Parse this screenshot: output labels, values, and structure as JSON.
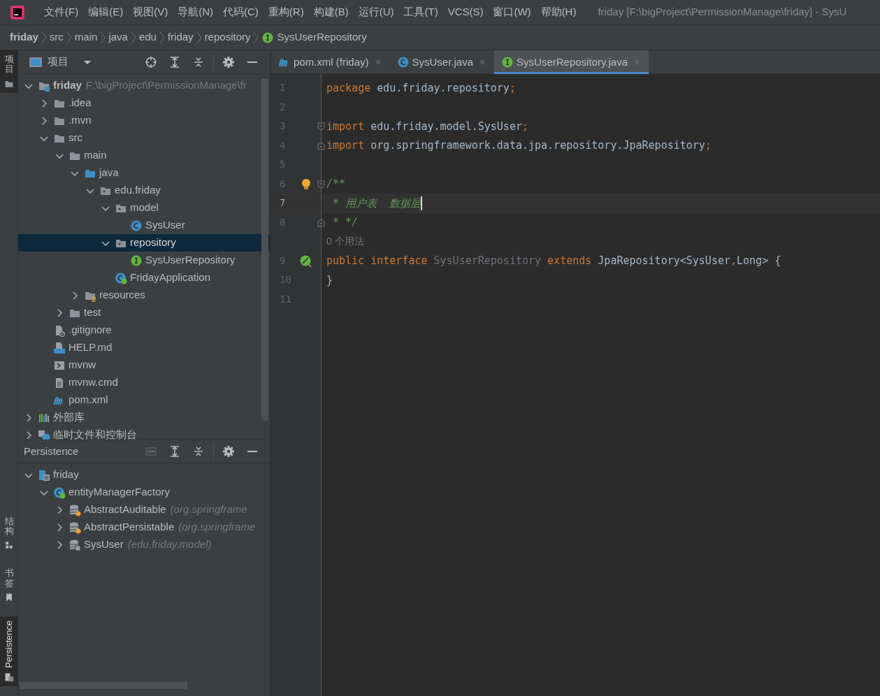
{
  "window": {
    "title": "friday [F:\\bigProject\\PermissionManage\\friday] - SysU"
  },
  "menu": [
    "文件(F)",
    "编辑(E)",
    "视图(V)",
    "导航(N)",
    "代码(C)",
    "重构(R)",
    "构建(B)",
    "运行(U)",
    "工具(T)",
    "VCS(S)",
    "窗口(W)",
    "帮助(H)"
  ],
  "breadcrumb": [
    {
      "label": "friday",
      "kind": "project"
    },
    {
      "label": "src",
      "kind": "dir"
    },
    {
      "label": "main",
      "kind": "dir"
    },
    {
      "label": "java",
      "kind": "dir"
    },
    {
      "label": "edu",
      "kind": "dir"
    },
    {
      "label": "friday",
      "kind": "dir"
    },
    {
      "label": "repository",
      "kind": "dir"
    },
    {
      "label": "SysUserRepository",
      "kind": "interface"
    }
  ],
  "side_tabs": [
    {
      "label": "项目",
      "kind": "project",
      "selected": true
    },
    {
      "label": "结构",
      "kind": "structure",
      "selected": false
    },
    {
      "label": "书签",
      "kind": "bookmarks",
      "selected": false
    },
    {
      "label": "Persistence",
      "kind": "persistence",
      "selected": true
    }
  ],
  "project_panel": {
    "title": "项目",
    "tree": [
      {
        "label": "friday",
        "detail": "F:\\bigProject\\PermissionManage\\fr",
        "kind": "module",
        "expanded": true,
        "selected": false,
        "children": [
          {
            "label": ".idea",
            "kind": "folder",
            "expanded": false,
            "selected": false
          },
          {
            "label": ".mvn",
            "kind": "folder",
            "expanded": false,
            "selected": false
          },
          {
            "label": "src",
            "kind": "folder",
            "expanded": true,
            "selected": false,
            "children": [
              {
                "label": "main",
                "kind": "folder",
                "expanded": true,
                "selected": false,
                "children": [
                  {
                    "label": "java",
                    "kind": "source",
                    "expanded": true,
                    "selected": false,
                    "children": [
                      {
                        "label": "edu.friday",
                        "kind": "package",
                        "expanded": true,
                        "selected": false,
                        "children": [
                          {
                            "label": "model",
                            "kind": "package",
                            "expanded": true,
                            "selected": false,
                            "children": [
                              {
                                "label": "SysUser",
                                "kind": "class",
                                "selected": false
                              }
                            ]
                          },
                          {
                            "label": "repository",
                            "kind": "package",
                            "expanded": true,
                            "selected": true,
                            "children": [
                              {
                                "label": "SysUserRepository",
                                "kind": "interface",
                                "selected": false
                              }
                            ]
                          },
                          {
                            "label": "FridayApplication",
                            "kind": "spring",
                            "selected": false
                          }
                        ]
                      }
                    ]
                  },
                  {
                    "label": "resources",
                    "kind": "resources",
                    "expanded": false,
                    "selected": false
                  }
                ]
              },
              {
                "label": "test",
                "kind": "folder",
                "expanded": false,
                "selected": false
              }
            ]
          },
          {
            "label": ".gitignore",
            "kind": "ignore",
            "selected": false
          },
          {
            "label": "HELP.md",
            "kind": "markdown",
            "selected": false
          },
          {
            "label": "mvnw",
            "kind": "shell",
            "selected": false
          },
          {
            "label": "mvnw.cmd",
            "kind": "text",
            "selected": false
          },
          {
            "label": "pom.xml",
            "kind": "maven",
            "selected": false
          }
        ]
      },
      {
        "label": "外部库",
        "kind": "library",
        "expanded": false,
        "selected": false
      },
      {
        "label": "临时文件和控制台",
        "kind": "scratch",
        "expanded": false,
        "selected": false
      }
    ]
  },
  "persistence_panel": {
    "title": "Persistence",
    "tree": [
      {
        "label": "friday",
        "kind": "persist",
        "expanded": true,
        "selected": false,
        "children": [
          {
            "label": "entityManagerFactory",
            "kind": "spring",
            "expanded": true,
            "selected": false,
            "children": [
              {
                "label": "AbstractAuditable",
                "detail": "(org.springframe",
                "kind": "entity-super",
                "expanded": false,
                "selected": false
              },
              {
                "label": "AbstractPersistable",
                "detail": "(org.springframe",
                "kind": "entity-super",
                "expanded": false,
                "selected": false
              },
              {
                "label": "SysUser",
                "detail": "(edu.friday.model)",
                "kind": "entity",
                "expanded": false,
                "selected": false
              }
            ]
          }
        ]
      }
    ]
  },
  "editor_tabs": [
    {
      "label": "pom.xml (friday)",
      "kind": "maven",
      "selected": false
    },
    {
      "label": "SysUser.java",
      "kind": "class",
      "selected": false
    },
    {
      "label": "SysUserRepository.java",
      "kind": "interface",
      "selected": true
    }
  ],
  "code": [
    {
      "kind": "line",
      "number": "1",
      "tokens": [
        {
          "kind": "keyword",
          "text": "package"
        },
        {
          "kind": "plain",
          "text": " edu.friday.repository"
        },
        {
          "kind": "keyword",
          "text": ";"
        }
      ]
    },
    {
      "kind": "line",
      "number": "2"
    },
    {
      "kind": "line",
      "number": "3",
      "fold_start": true,
      "tokens": [
        {
          "kind": "keyword",
          "text": "import"
        },
        {
          "kind": "plain",
          "text": " edu.friday.model.SysUser"
        },
        {
          "kind": "keyword",
          "text": ";"
        }
      ]
    },
    {
      "kind": "line",
      "number": "4",
      "fold_end": true,
      "tokens": [
        {
          "kind": "keyword",
          "text": "import"
        },
        {
          "kind": "plain",
          "text": " org.springframework.data.jpa.repository.JpaRepository"
        },
        {
          "kind": "keyword",
          "text": ";"
        }
      ]
    },
    {
      "kind": "line",
      "number": "5"
    },
    {
      "kind": "line",
      "number": "6",
      "fold_start": true,
      "bulb": true,
      "tokens": [
        {
          "kind": "comment",
          "text": "/**"
        }
      ]
    },
    {
      "kind": "line",
      "number": "7",
      "current": true,
      "tokens": [
        {
          "kind": "comment",
          "text": " * 用户表  数据层"
        }
      ]
    },
    {
      "kind": "line",
      "number": "8",
      "fold_end": true,
      "tokens": [
        {
          "kind": "comment",
          "text": " * */"
        }
      ]
    },
    {
      "kind": "hint",
      "text": "0 个用法"
    },
    {
      "kind": "line",
      "number": "9",
      "bean": true,
      "tokens": [
        {
          "kind": "keyword",
          "text": "public interface "
        },
        {
          "kind": "unused",
          "text": "SysUserRepository"
        },
        {
          "kind": "keyword",
          "text": " extends "
        },
        {
          "kind": "plain",
          "text": "JpaRepository<SysUser"
        },
        {
          "kind": "keyword",
          "text": ","
        },
        {
          "kind": "plain",
          "text": "Long> {"
        }
      ]
    },
    {
      "kind": "line",
      "number": "10",
      "tokens": [
        {
          "kind": "plain",
          "text": "}"
        }
      ]
    },
    {
      "kind": "line",
      "number": "11"
    }
  ]
}
